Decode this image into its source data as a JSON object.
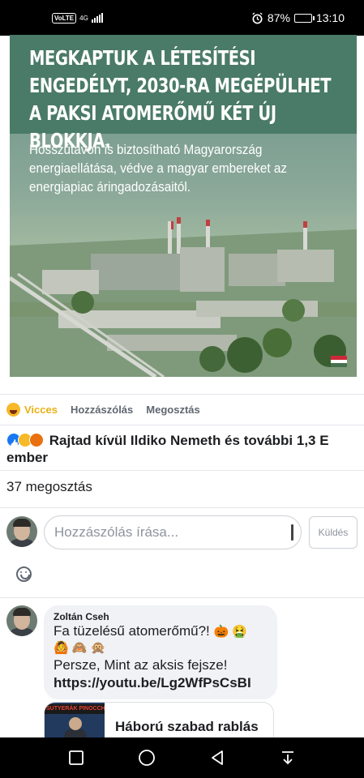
{
  "status_bar": {
    "volte": "VoLTE",
    "network": "4G",
    "battery": "87%",
    "battery_level": 0.87,
    "time": "13:10"
  },
  "post": {
    "image_headline": "MEGKAPTUK A LÉTESÍTÉSI ENGEDÉLYT, 2030-RA MEGÉPÜLHET A PAKSI ATOMERŐMŰ KÉT ÚJ BLOKKJA.",
    "image_subtext": "Hosszútávon is biztosítható Magyarország energiaellátása, védve a magyar embereket az energiapiac áringadozásaitól.",
    "actions": {
      "reaction": "Vicces",
      "comment": "Hozzászólás",
      "share": "Megosztás"
    },
    "reactions_summary": "Rajtad kívül Ildiko Nemeth és további 1,3 E ember",
    "shares_count": "37 megosztás"
  },
  "composer": {
    "placeholder": "Hozzászólás írása...",
    "send_label": "Küldés"
  },
  "comment": {
    "author": "Zoltán Cseh",
    "line1": "Fa tüzelésű atomerőmű?!",
    "line1_emojis": "🎃 🤮",
    "emojis_line": "🙆 🙈 🙊",
    "line3": "Persze, Mint az aksis fejsze!",
    "link": "https://youtu.be/Lg2WfPsCsBI",
    "preview_thumb_text": "SUTYERÁK PINOCCHIO",
    "preview_title": "Háború szabad rablás"
  },
  "colors": {
    "accent_haha": "#e9b116",
    "facebook_blue": "#1877f2",
    "image_band": "#4a7a68"
  }
}
